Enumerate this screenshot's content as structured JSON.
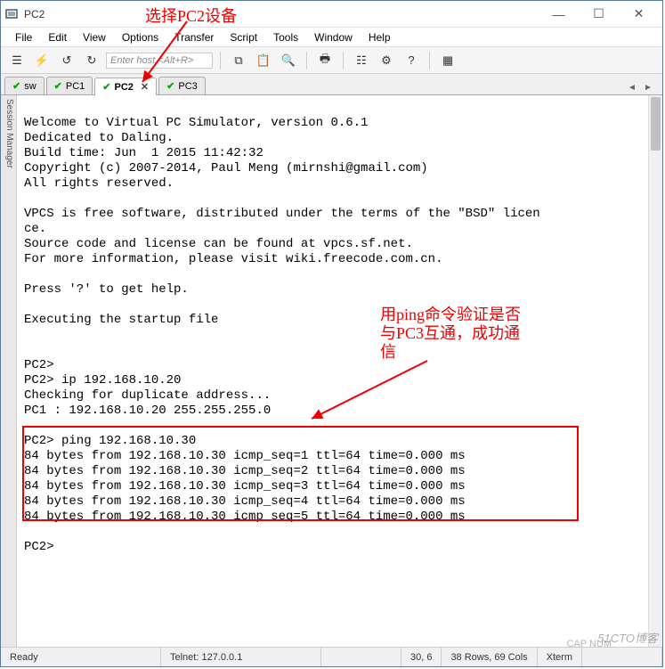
{
  "window": {
    "title": "PC2"
  },
  "menu": {
    "file": "File",
    "edit": "Edit",
    "view": "View",
    "options": "Options",
    "transfer": "Transfer",
    "script": "Script",
    "tools": "Tools",
    "window": "Window",
    "help": "Help"
  },
  "toolbar": {
    "host_placeholder": "Enter host <Alt+R>"
  },
  "tabs": [
    {
      "label": "sw"
    },
    {
      "label": "PC1"
    },
    {
      "label": "PC2",
      "active": true
    },
    {
      "label": "PC3"
    }
  ],
  "side_panel": "Session Manager",
  "terminal_lines": [
    "",
    "Welcome to Virtual PC Simulator, version 0.6.1",
    "Dedicated to Daling.",
    "Build time: Jun  1 2015 11:42:32",
    "Copyright (c) 2007-2014, Paul Meng (mirnshi@gmail.com)",
    "All rights reserved.",
    "",
    "VPCS is free software, distributed under the terms of the \"BSD\" licen",
    "ce.",
    "Source code and license can be found at vpcs.sf.net.",
    "For more information, please visit wiki.freecode.com.cn.",
    "",
    "Press '?' to get help.",
    "",
    "Executing the startup file",
    "",
    "",
    "PC2>",
    "PC2> ip 192.168.10.20",
    "Checking for duplicate address...",
    "PC1 : 192.168.10.20 255.255.255.0",
    "",
    "PC2> ping 192.168.10.30",
    "84 bytes from 192.168.10.30 icmp_seq=1 ttl=64 time=0.000 ms",
    "84 bytes from 192.168.10.30 icmp_seq=2 ttl=64 time=0.000 ms",
    "84 bytes from 192.168.10.30 icmp_seq=3 ttl=64 time=0.000 ms",
    "84 bytes from 192.168.10.30 icmp_seq=4 ttl=64 time=0.000 ms",
    "84 bytes from 192.168.10.30 icmp_seq=5 ttl=64 time=0.000 ms",
    "",
    "PC2>"
  ],
  "status": {
    "ready": "Ready",
    "conn": "Telnet: 127.0.0.1",
    "pos": "30,  6",
    "size": "38 Rows, 69 Cols",
    "term": "Xterm",
    "caps": "CAP  NUM"
  },
  "annotations": {
    "top": "选择PC2设备",
    "right1": "用ping命令验证是否",
    "right2": "与PC3互通，成功通",
    "right3": "信",
    "watermark": "51CTO博客"
  }
}
